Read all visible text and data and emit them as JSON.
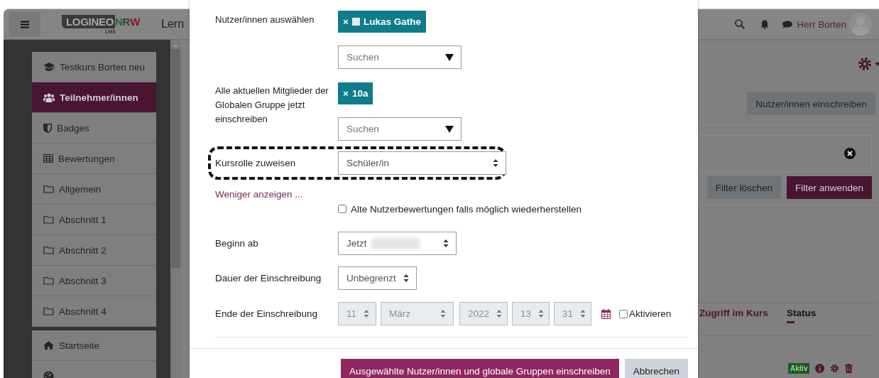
{
  "header": {
    "logo": {
      "main": "LOGINEO",
      "accent": [
        {
          "text": "N",
          "color": "#1d6e36"
        },
        {
          "text": "R",
          "color": "#3e3e3e"
        },
        {
          "text": "W",
          "color": "#8a1b22"
        }
      ],
      "sub": "LMS"
    },
    "site_title": "Lern",
    "user_name": "Herr Borten"
  },
  "sidebar": {
    "groups": [
      [
        {
          "label": "Testkurs Borten neu",
          "kind": "course",
          "selected": false
        },
        {
          "label": "Teilnehmer/innen",
          "kind": "participants",
          "selected": true
        },
        {
          "label": "Badges",
          "kind": "badges",
          "selected": false
        },
        {
          "label": "Bewertungen",
          "kind": "grades",
          "selected": false
        },
        {
          "label": "Allgemein",
          "kind": "section",
          "selected": false
        },
        {
          "label": "Abschnitt 1",
          "kind": "section",
          "selected": false
        },
        {
          "label": "Abschnitt 2",
          "kind": "section",
          "selected": false
        },
        {
          "label": "Abschnitt 3",
          "kind": "section",
          "selected": false
        },
        {
          "label": "Abschnitt 4",
          "kind": "section",
          "selected": false
        }
      ],
      [
        {
          "label": "Startseite",
          "kind": "home",
          "selected": false
        },
        {
          "kind": "dashboard",
          "selected": false
        }
      ]
    ]
  },
  "page": {
    "enrol_button": "Nutzer/innen einschreiben",
    "filter_buttons": [
      {
        "label": "Filter löschen",
        "kind": "secondary"
      },
      {
        "label": "Filter anwenden",
        "kind": "primary"
      }
    ],
    "table": {
      "columns": [
        {
          "label": "Zugriff im Kurs",
          "sorted": false
        },
        {
          "label": "Status",
          "sorted": true
        }
      ],
      "rows": [
        {
          "status": "Aktiv"
        }
      ]
    }
  },
  "modal": {
    "fields": [
      {
        "kind": "autocomplete",
        "label": "Nutzer/innen auswählen",
        "chips": [
          {
            "remove": "×",
            "text": "Lukas Gathe",
            "avatar": true
          }
        ],
        "placeholder": "Suchen"
      },
      {
        "kind": "autocomplete",
        "label": "Alle aktuellen Mitglieder der Globalen Gruppe jetzt einschreiben",
        "chips": [
          {
            "remove": "×",
            "text": "10a",
            "avatar": false
          }
        ],
        "placeholder": "Suchen"
      },
      {
        "kind": "select",
        "label": "Kursrolle zuweisen",
        "value": "Schüler/in",
        "highlighted": true
      },
      {
        "kind": "link",
        "text": "Weniger anzeigen ..."
      },
      {
        "kind": "checkbox",
        "text": "Alte Nutzerbewertungen falls möglich wiederherstellen",
        "checked": false
      },
      {
        "kind": "select",
        "label": "Beginn ab",
        "value": "Jetzt",
        "redacted": true
      },
      {
        "kind": "select",
        "label": "Dauer der Einschreibung",
        "value": "Unbegrenzt"
      },
      {
        "kind": "date",
        "label": "Ende der Einschreibung",
        "parts": [
          "11",
          "März",
          "2022",
          "13",
          "31"
        ],
        "disabled": true,
        "enable": {
          "text": "Aktivieren",
          "checked": false
        }
      }
    ],
    "buttons": [
      {
        "label": "Ausgewählte Nutzer/innen und globale Gruppen einschreiben",
        "kind": "primary"
      },
      {
        "label": "Abbrechen",
        "kind": "secondary"
      }
    ]
  }
}
